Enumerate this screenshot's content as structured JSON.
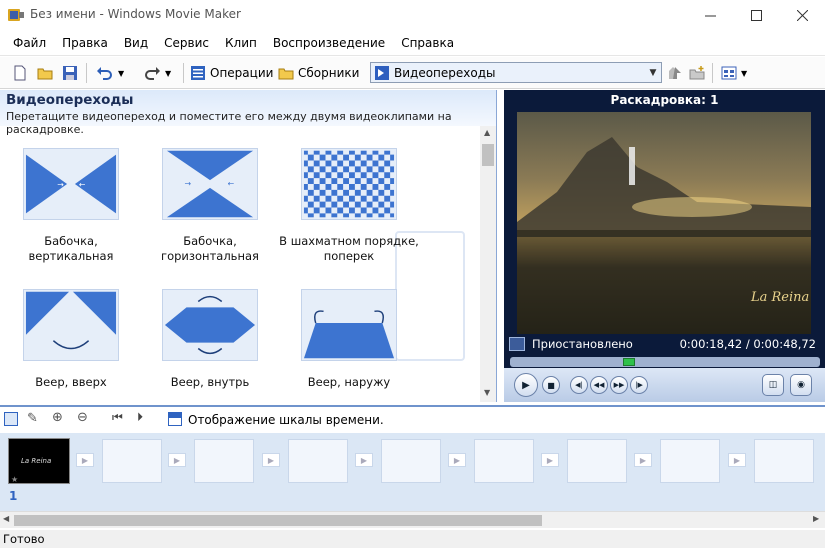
{
  "window": {
    "title": "Без имени - Windows Movie Maker"
  },
  "menu": [
    "Файл",
    "Правка",
    "Вид",
    "Сервис",
    "Клип",
    "Воспроизведение",
    "Справка"
  ],
  "toolbar": {
    "operations_label": "Операции",
    "collections_label": "Сборники",
    "combo_value": "Видеопереходы"
  },
  "panel": {
    "title": "Видеопереходы",
    "subtitle": "Перетащите видеопереход и поместите его между двумя видеоклипами на раскадровке.",
    "transitions": [
      {
        "label": "Бабочка, вертикальная",
        "icon": "butterfly-vertical-icon"
      },
      {
        "label": "Бабочка, горизонтальная",
        "icon": "butterfly-horizontal-icon"
      },
      {
        "label": "В шахматном порядке, поперек",
        "icon": "checkerboard-icon"
      },
      {
        "label": "Веер, вверх",
        "icon": "fan-up-icon"
      },
      {
        "label": "Веер, внутрь",
        "icon": "fan-in-icon"
      },
      {
        "label": "Веер, наружу",
        "icon": "fan-out-icon"
      }
    ]
  },
  "preview": {
    "label": "Раскадровка: 1",
    "status": "Приостановлено",
    "time": "0:00:18,42 / 0:00:48,72",
    "seek_fraction": 0.378,
    "video_watermark": "La Reina"
  },
  "bottom": {
    "timeline_label": "Отображение шкалы времени.",
    "clip_index": "1",
    "status": "Готово"
  },
  "colors": {
    "accent": "#3f78d1",
    "panel_border": "#8aa7d6",
    "preview_bg": "#0b1a3a"
  }
}
